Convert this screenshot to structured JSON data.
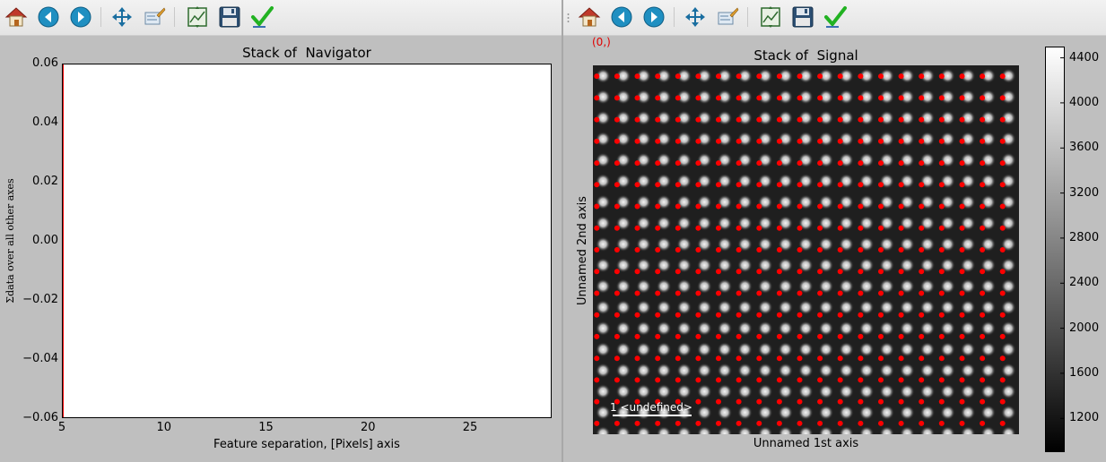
{
  "left_window": {
    "plot": {
      "title": "Stack of  Navigator",
      "xlabel": "Feature separation, [Pixels] axis",
      "ylabel": "Σdata over all other axes",
      "yticks": [
        "0.06",
        "0.04",
        "0.02",
        "0.00",
        "−0.02",
        "−0.04",
        "−0.06"
      ],
      "xticks": [
        "5",
        "10",
        "15",
        "20",
        "25"
      ]
    }
  },
  "right_window": {
    "coord_readout": "(0,)",
    "plot": {
      "title": "Stack of  Signal",
      "xlabel": "Unnamed 1st axis",
      "ylabel": "Unnamed 2nd axis",
      "scalebar_label": "1 <undefined>"
    },
    "colorbar": {
      "ticks": [
        "4400",
        "4000",
        "3600",
        "3200",
        "2800",
        "2400",
        "2000",
        "1600",
        "1200"
      ]
    }
  },
  "toolbar": {
    "buttons": [
      {
        "name": "home-button",
        "icon": "home-icon"
      },
      {
        "name": "back-button",
        "icon": "arrow-left-icon"
      },
      {
        "name": "forward-button",
        "icon": "arrow-right-icon"
      },
      {
        "name": "pan-button",
        "icon": "move-arrows-icon"
      },
      {
        "name": "zoom-button",
        "icon": "zoom-rect-icon"
      },
      {
        "name": "subplots-button",
        "icon": "subplots-icon"
      },
      {
        "name": "save-button",
        "icon": "floppy-disk-icon"
      },
      {
        "name": "edit-button",
        "icon": "checkmark-icon"
      }
    ]
  },
  "chart_data": [
    {
      "type": "line",
      "title": "Stack of  Navigator",
      "xlabel": "Feature separation, [Pixels] axis",
      "ylabel": "Σdata over all other axes",
      "xlim": [
        5,
        29
      ],
      "ylim": [
        -0.06,
        0.06
      ],
      "series": [],
      "vertical_marker_x": 5,
      "grid": false
    },
    {
      "type": "heatmap",
      "title": "Stack of  Signal",
      "xlabel": "Unnamed 1st axis",
      "ylabel": "Unnamed 2nd axis",
      "colormap": "gray",
      "colorbar_range": [
        900,
        4500
      ],
      "colorbar_ticks": [
        1200,
        1600,
        2000,
        2400,
        2800,
        3200,
        3600,
        4000,
        4400
      ],
      "lattice": {
        "columns": 21,
        "rows": 17
      },
      "marker_color": "#ff0000",
      "grid": false
    }
  ]
}
